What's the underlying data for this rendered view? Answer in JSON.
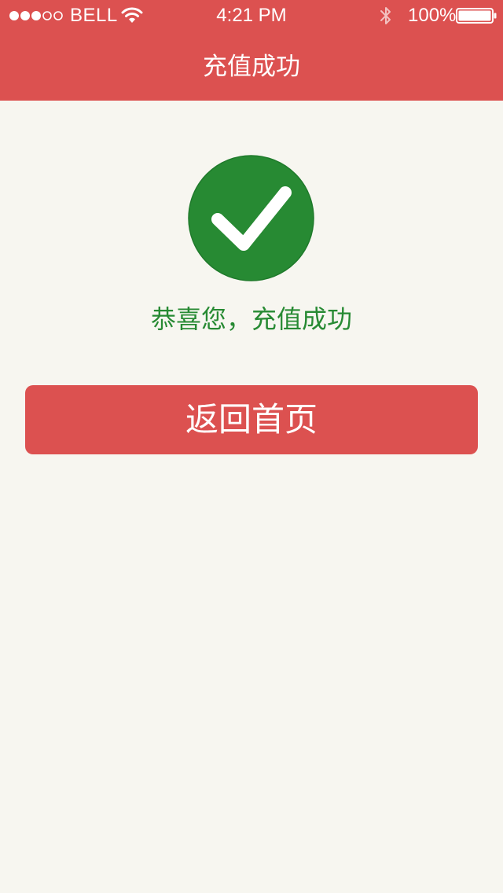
{
  "status_bar": {
    "carrier": "BELL",
    "time": "4:21 PM",
    "battery_percent": "100%",
    "signal_bars_filled": 3,
    "signal_bars_total": 5,
    "battery_level": 1.0
  },
  "nav": {
    "title": "充值成功"
  },
  "result": {
    "icon": "check-circle-icon",
    "message": "恭喜您，充值成功"
  },
  "actions": {
    "home_label": "返回首页"
  },
  "colors": {
    "brand_red": "#dc5150",
    "success_green": "#278a33",
    "background": "#f7f6f0"
  }
}
